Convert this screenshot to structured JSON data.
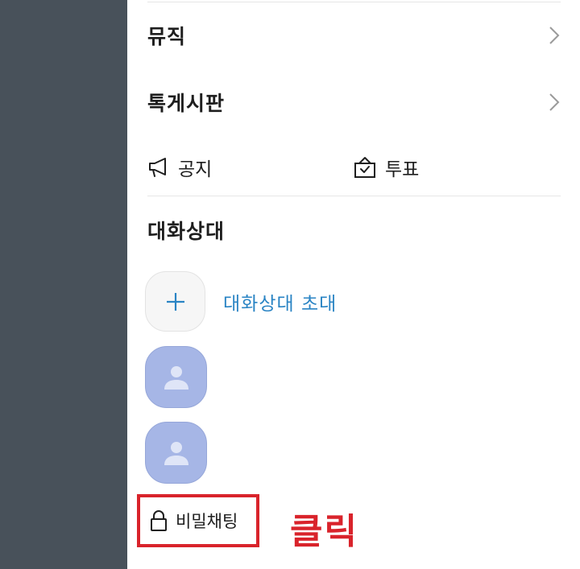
{
  "menu": {
    "music_label": "뮤직",
    "board_label": "톡게시판"
  },
  "quick_actions": {
    "notice_label": "공지",
    "vote_label": "투표"
  },
  "participants": {
    "title": "대화상대",
    "invite_label": "대화상대 초대",
    "member_count": 2
  },
  "secret_chat": {
    "label": "비밀채팅"
  },
  "annotation": {
    "click_text": "클릭"
  },
  "colors": {
    "overlay": "#48515a",
    "accent_blue": "#2a84c4",
    "avatar_bg": "#a6b6e6",
    "annotation_red": "#d9232b"
  },
  "icons": [
    "chevron-right-icon",
    "megaphone-icon",
    "ballot-box-icon",
    "plus-icon",
    "person-icon",
    "lock-icon"
  ]
}
